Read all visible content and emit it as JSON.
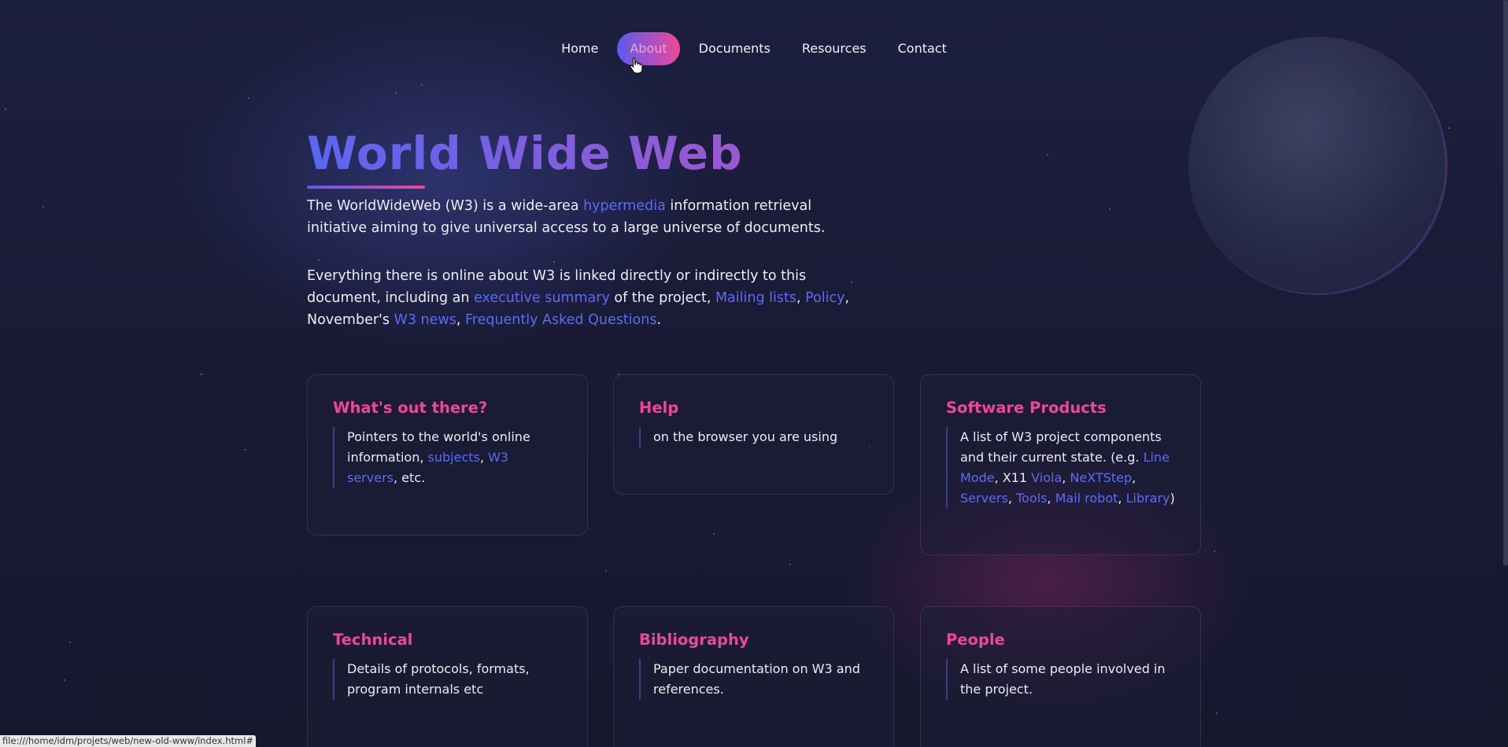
{
  "nav": {
    "items": [
      {
        "label": "Home"
      },
      {
        "label": "About"
      },
      {
        "label": "Documents"
      },
      {
        "label": "Resources"
      },
      {
        "label": "Contact"
      }
    ]
  },
  "hero": {
    "title": "World Wide Web",
    "p1_a": "The WorldWideWeb (W3) is a wide-area ",
    "p1_link": "hypermedia",
    "p1_b": " information retrieval initiative aiming to give universal access to a large universe of documents.",
    "p2_a": "Everything there is online about W3 is linked directly or indirectly to this document, including an ",
    "p2_link1": "executive summary",
    "p2_b": " of the project, ",
    "p2_link2": "Mailing lists",
    "sep": ", ",
    "p2_link3": "Policy",
    "p2_c": ", November's ",
    "p2_link4": "W3 news",
    "p2_link5": "Frequently Asked Questions",
    "p2_end": "."
  },
  "cards": {
    "whats_out": {
      "title": "What's out there?",
      "text_a": "Pointers to the world's online information, ",
      "link1": "subjects",
      "sep": ", ",
      "link2": "W3 servers",
      "text_b": ", etc."
    },
    "help": {
      "title": "Help",
      "text": "on the browser you are using"
    },
    "software": {
      "title": "Software Products",
      "text_a": "A list of W3 project components and their current state. (e.g. ",
      "link1": "Line Mode",
      "text_b": ", X11 ",
      "link2": "Viola",
      "sep": ", ",
      "link3": "NeXTStep",
      "link4": "Servers",
      "link5": "Tools",
      "link6": "Mail robot",
      "link7": "Library",
      "text_end": ")"
    },
    "technical": {
      "title": "Technical",
      "text": "Details of protocols, formats, program internals etc"
    },
    "bibliography": {
      "title": "Bibliography",
      "text": "Paper documentation on W3 and references."
    },
    "people": {
      "title": "People",
      "text": "A list of some people involved in the project."
    }
  },
  "status_bar": {
    "url": "file:///home/idm/projets/web/new-old-www/index.html#"
  },
  "colors": {
    "accent_blue": "#5b6cf2",
    "accent_pink": "#ec4899",
    "background": "#17182e"
  },
  "icons": {
    "cursor": "hand-pointer-icon"
  }
}
